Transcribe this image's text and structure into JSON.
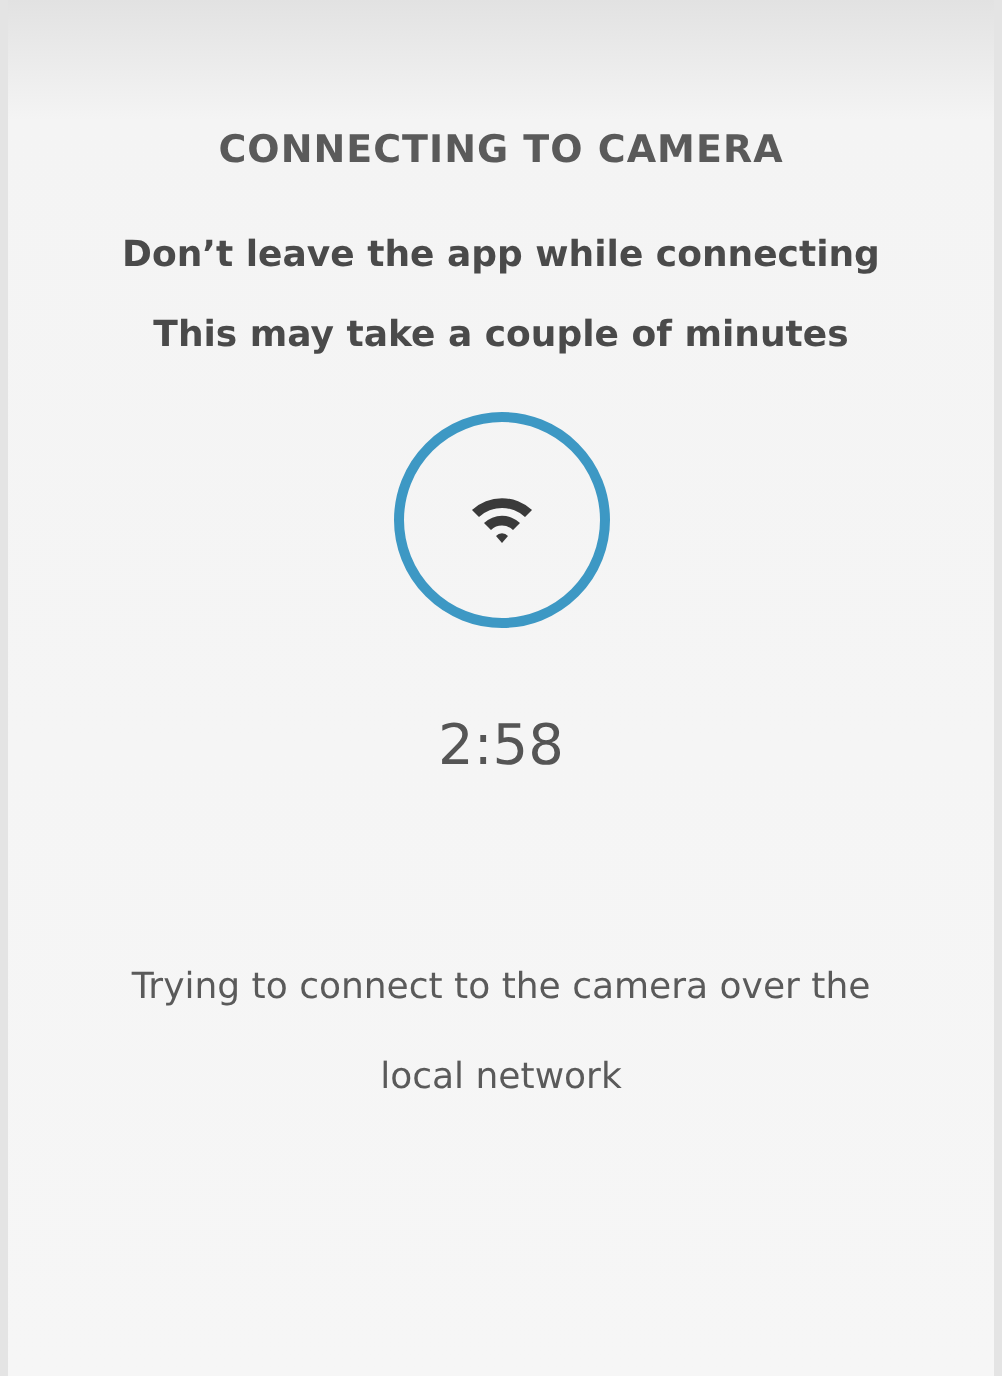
{
  "title": "CONNECTING TO CAMERA",
  "warning": [
    "Don’t leave the app while connecting",
    "This may take a couple of minutes"
  ],
  "countdown": "2:58",
  "status": "Trying to connect to the camera over the local network"
}
